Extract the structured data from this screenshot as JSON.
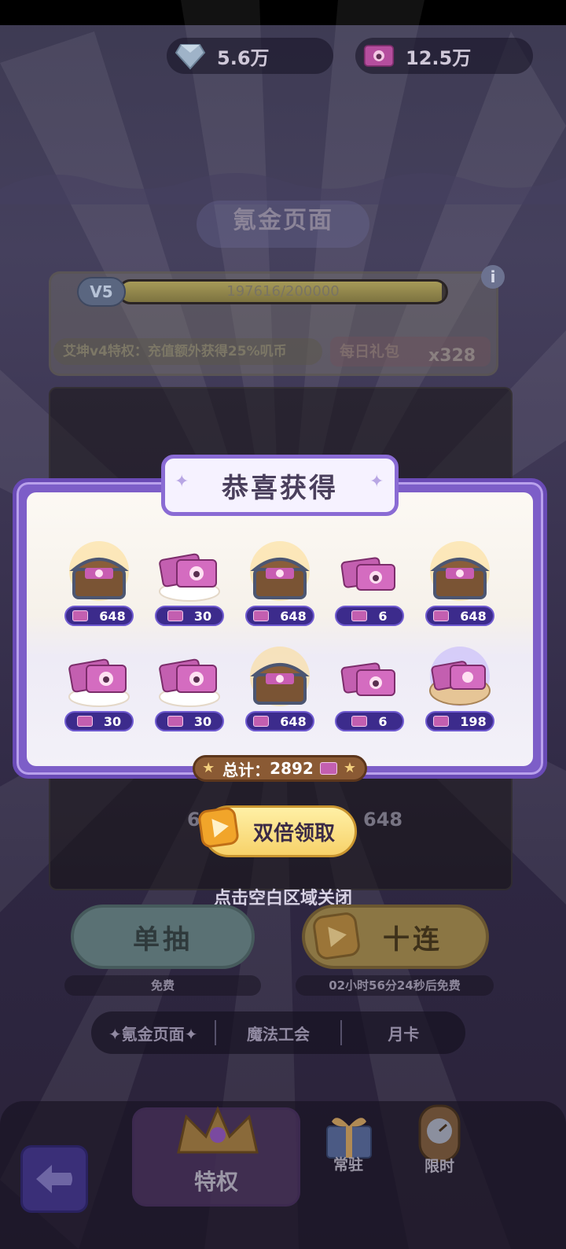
{
  "resources": {
    "diamonds": "5.6万",
    "coins": "12.5万"
  },
  "page_title": "氪金页面",
  "vip": {
    "level": "V5",
    "progress_text": "197616/200000",
    "progress_ratio": 0.988,
    "privilege_text": "艾坤v4特权：充值额外获得25%叽币",
    "daily_gift_label": "每日礼包",
    "daily_gift_count": "x328"
  },
  "modal": {
    "title": "恭喜获得",
    "rewards": [
      {
        "type": "chest",
        "qty": "648"
      },
      {
        "type": "tickets-plate",
        "qty": "30"
      },
      {
        "type": "chest",
        "qty": "648"
      },
      {
        "type": "tickets",
        "qty": "6"
      },
      {
        "type": "chest",
        "qty": "648"
      },
      {
        "type": "tickets-plate",
        "qty": "30"
      },
      {
        "type": "tickets-plate",
        "qty": "30"
      },
      {
        "type": "chest",
        "qty": "648"
      },
      {
        "type": "tickets",
        "qty": "6"
      },
      {
        "type": "tickets-bun",
        "qty": "198"
      }
    ],
    "total_label": "总计：",
    "total_value": "2892",
    "double_button": "双倍领取",
    "close_hint": "点击空白区域关闭"
  },
  "background_row": [
    "6",
    "648"
  ],
  "draw": {
    "single_label": "单抽",
    "single_sub": "免费",
    "ten_label": "十连",
    "ten_sub": "02小时56分24秒后免费"
  },
  "tabs": [
    "✦氪金页面✦",
    "魔法工会",
    "月卡"
  ],
  "bottom_nav": {
    "main": "特权",
    "item2": "常驻",
    "item3": "限时"
  },
  "colors": {
    "modal_border": "#7d5ec8",
    "qty_pill": "#3c2b8c",
    "gold_button": "#f7d26a",
    "total_pill": "#8a5a34"
  }
}
